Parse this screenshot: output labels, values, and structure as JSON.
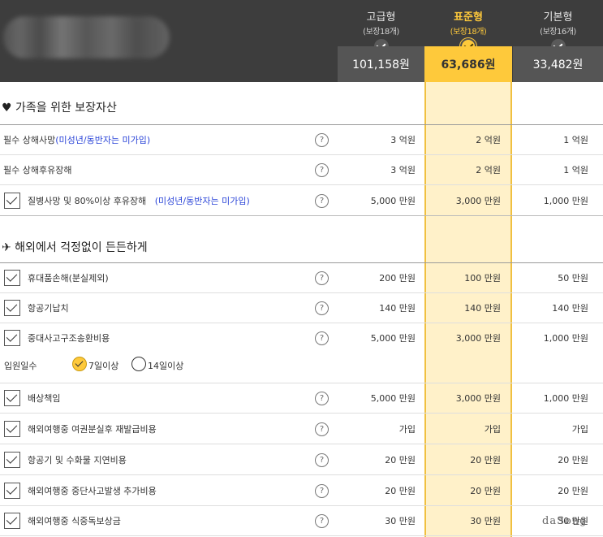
{
  "plans": [
    {
      "name": "고급형",
      "sub": "(보장18개)",
      "price": "101,158원",
      "selected": false
    },
    {
      "name": "표준형",
      "sub": "(보장18개)",
      "price": "63,686원",
      "selected": true
    },
    {
      "name": "기본형",
      "sub": "(보장16개)",
      "price": "33,482원",
      "selected": false
    }
  ],
  "sections": [
    {
      "title": "♥ 가족을 위한 보장자산"
    },
    {
      "title": "✈ 해외에서 걱정없이 든든하게"
    }
  ],
  "rows": [
    {
      "label": "필수 상해사망",
      "note": "(미성년/동반자는 미가입)",
      "checkbox": false,
      "v1": "3 억원",
      "v2": "2 억원",
      "v3": "1 억원"
    },
    {
      "label": "필수 상해후유장해",
      "note": "",
      "checkbox": false,
      "v1": "3 억원",
      "v2": "2 억원",
      "v3": "1 억원"
    },
    {
      "label": "질병사망 및 80%이상 후유장해",
      "note": "(미성년/동반자는 미가입)",
      "checkbox": true,
      "v1": "5,000 만원",
      "v2": "3,000 만원",
      "v3": "1,000 만원"
    },
    {
      "label": "휴대품손해(분실제외)",
      "note": "",
      "checkbox": true,
      "v1": "200 만원",
      "v2": "100 만원",
      "v3": "50 만원"
    },
    {
      "label": "항공기납치",
      "note": "",
      "checkbox": true,
      "v1": "140 만원",
      "v2": "140 만원",
      "v3": "140 만원"
    },
    {
      "label": "중대사고구조송환비용",
      "note": "",
      "checkbox": true,
      "v1": "5,000 만원",
      "v2": "3,000 만원",
      "v3": "1,000 만원"
    },
    {
      "label": "배상책임",
      "note": "",
      "checkbox": true,
      "v1": "5,000 만원",
      "v2": "3,000 만원",
      "v3": "1,000 만원"
    },
    {
      "label": "해외여행중 여권분실후 재발급비용",
      "note": "",
      "checkbox": true,
      "v1": "가입",
      "v2": "가입",
      "v3": "가입"
    },
    {
      "label": "항공기 및 수화물 지연비용",
      "note": "",
      "checkbox": true,
      "v1": "20 만원",
      "v2": "20 만원",
      "v3": "20 만원"
    },
    {
      "label": "해외여행중 중단사고발생 추가비용",
      "note": "",
      "checkbox": true,
      "v1": "20 만원",
      "v2": "20 만원",
      "v3": "20 만원"
    },
    {
      "label": "해외여행중 식중독보상금",
      "note": "",
      "checkbox": true,
      "v1": "30 만원",
      "v2": "30 만원",
      "v3": "30 만원"
    }
  ],
  "hospital": {
    "label": "입원일수",
    "options": [
      {
        "label": "7일이상",
        "selected": true
      },
      {
        "label": "14일이상",
        "selected": false
      }
    ]
  },
  "help_glyph": "?",
  "watermark": "daSong",
  "colors": {
    "accent": "#fec93b",
    "header_bg": "#3d3d3d",
    "note": "#2b45d8"
  }
}
